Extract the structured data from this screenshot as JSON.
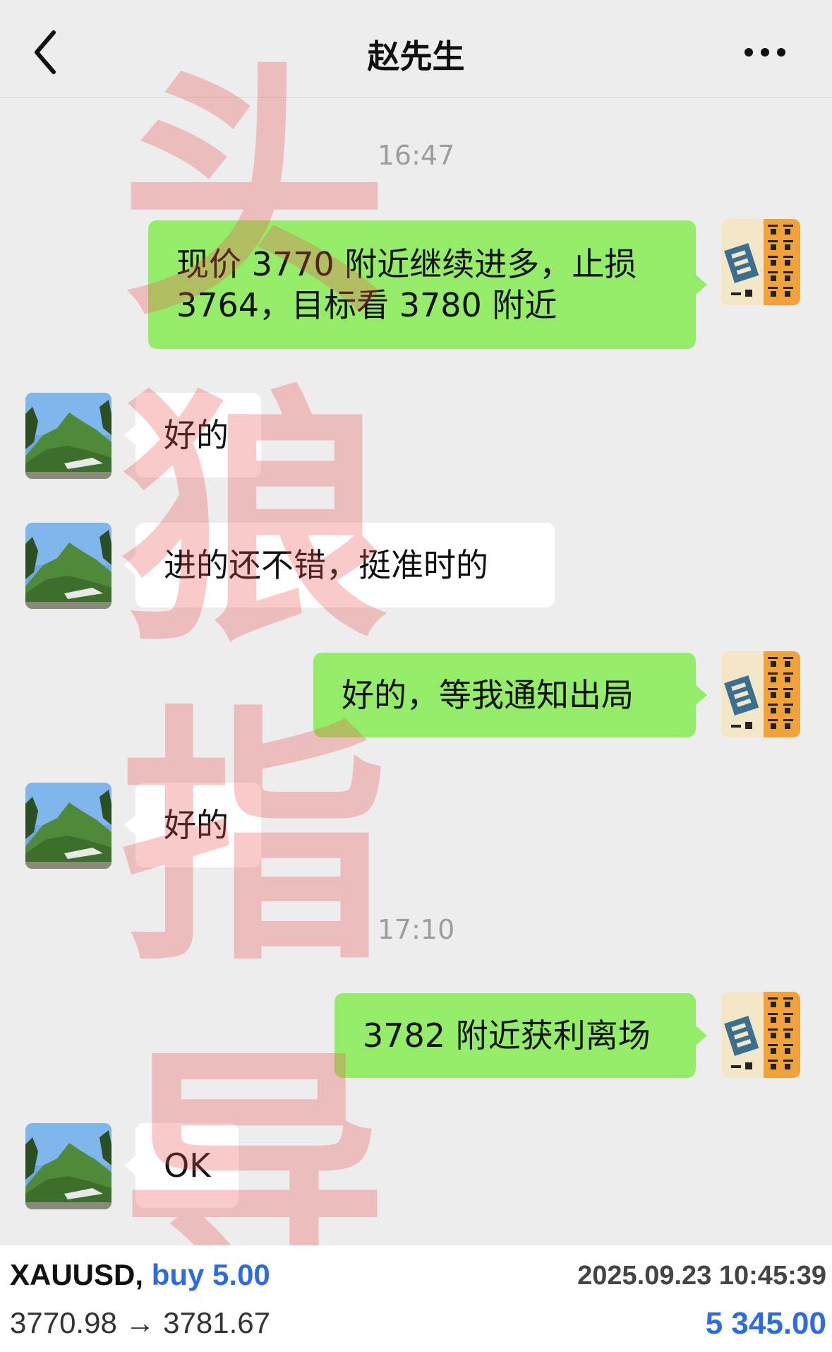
{
  "header": {
    "title": "赵先生",
    "back_icon": "chevron-left-icon",
    "more_icon": "more-dots-icon"
  },
  "messages": [
    {
      "type": "time",
      "text": "16:47"
    },
    {
      "type": "out",
      "lines": [
        "现价 3770 附近继续进多，止损",
        "3764，目标看 3780 附近"
      ]
    },
    {
      "type": "in",
      "text": "好的"
    },
    {
      "type": "in",
      "text": "进的还不错，挺准时的"
    },
    {
      "type": "out",
      "text": "好的，等我通知出局"
    },
    {
      "type": "in",
      "text": "好的"
    },
    {
      "type": "time",
      "text": "17:10"
    },
    {
      "type": "out",
      "text": "3782 附近获利离场"
    },
    {
      "type": "in",
      "text": "OK"
    }
  ],
  "watermark": {
    "chars": [
      "头",
      "狼",
      "指",
      "导"
    ],
    "color": "#ee5050"
  },
  "avatars": {
    "self": "calligraphy-avatar",
    "contact": "mountain-landscape-avatar"
  },
  "trade": {
    "symbol": "XAUUSD,",
    "side": "buy 5.00",
    "prices": "3770.98 → 3781.67",
    "datetime": "2025.09.23 10:45:39",
    "profit": "5 345.00"
  },
  "colors": {
    "outgoing_bubble": "#95ec69",
    "incoming_bubble": "#ffffff",
    "background": "#ededed",
    "profit_blue": "#2d6be0"
  }
}
